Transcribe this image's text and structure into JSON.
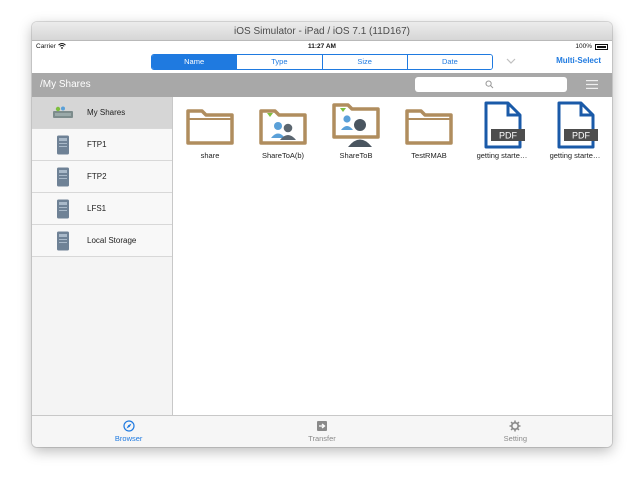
{
  "window": {
    "title": "iOS Simulator - iPad / iOS 7.1 (11D167)"
  },
  "status": {
    "carrier": "Carrier",
    "time": "11:27 AM",
    "battery": "100%"
  },
  "sort_tabs": [
    {
      "label": "Name",
      "active": true
    },
    {
      "label": "Type",
      "active": false
    },
    {
      "label": "Size",
      "active": false
    },
    {
      "label": "Date",
      "active": false
    }
  ],
  "toolbar": {
    "multi_select": "Multi-Select"
  },
  "path": {
    "title": "/My Shares",
    "search_placeholder": ""
  },
  "sidebar": {
    "items": [
      {
        "label": "My Shares",
        "icon": "shares-icon",
        "selected": true
      },
      {
        "label": "FTP1",
        "icon": "server-icon",
        "selected": false
      },
      {
        "label": "FTP2",
        "icon": "server-icon",
        "selected": false
      },
      {
        "label": "LFS1",
        "icon": "server-icon",
        "selected": false
      },
      {
        "label": "Local Storage",
        "icon": "server-icon",
        "selected": false
      }
    ]
  },
  "files": [
    {
      "label": "share",
      "icon": "folder-icon"
    },
    {
      "label": "ShareToA(b)",
      "icon": "shared-folder-icon"
    },
    {
      "label": "ShareToB",
      "icon": "shared-folder-icon"
    },
    {
      "label": "TestRMAB",
      "icon": "folder-icon"
    },
    {
      "label": "getting starte…",
      "icon": "pdf-icon"
    },
    {
      "label": "getting starte…",
      "icon": "pdf-icon"
    }
  ],
  "tabbar": [
    {
      "label": "Browser",
      "icon": "compass-icon",
      "active": true
    },
    {
      "label": "Transfer",
      "icon": "transfer-icon",
      "active": false
    },
    {
      "label": "Setting",
      "icon": "gear-icon",
      "active": false
    }
  ],
  "colors": {
    "accent": "#1f7ae0",
    "folder": "#b08d5e",
    "pdf": "#1a5aa8"
  }
}
